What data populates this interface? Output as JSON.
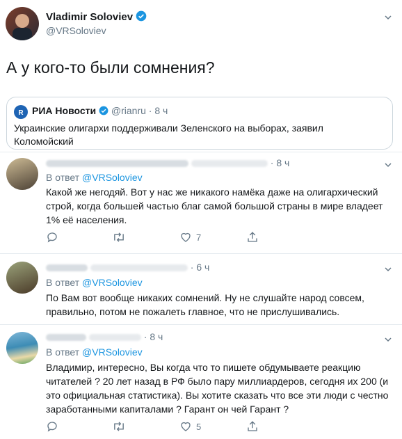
{
  "main_tweet": {
    "name": "Vladimir Soloviev",
    "handle": "@VRSoloviev",
    "text": "А у кого-то были сомнения?"
  },
  "quoted": {
    "name": "РИА Новости",
    "handle": "@rianru",
    "time": "· 8 ч",
    "text_line1": "Украинские олигархи поддерживали Зеленского на выборах, заявил",
    "text_line2": "Коломойский"
  },
  "replies": [
    {
      "time": "· 8 ч",
      "reply_prefix": "В ответ",
      "reply_to": "@VRSoloviev",
      "lines": [
        "Какой же негодяй. Вот у нас же никакого намёка даже на олигархический",
        "строй, когда большей частью благ самой большой страны в мире владеет",
        "1% её населения."
      ],
      "like_count": "7"
    },
    {
      "time": "· 6 ч",
      "reply_prefix": "В ответ",
      "reply_to": "@VRSoloviev",
      "lines": [
        "По Вам вот вообще никаких сомнений. Ну не слушайте народ совсем,",
        "правильно, потом не пожалеть главное, что не прислушивались."
      ]
    },
    {
      "time": "· 8 ч",
      "reply_prefix": "В ответ",
      "reply_to": "@VRSoloviev",
      "lines": [
        "Владимир, интересно, Вы когда что то пишете обдумываете реакцию",
        "читателей ? 20 лет назад в РФ было пару миллиардеров, сегодня их 200 (и",
        "это официальная статистика). Вы хотите сказать что все эти люди с честно",
        "заработанными капиталами ? Гарант он чей Гарант ?"
      ],
      "like_count": "5"
    }
  ],
  "colors": {
    "accent": "#1b95e0",
    "muted": "#657786",
    "border": "#e6ecf0"
  }
}
